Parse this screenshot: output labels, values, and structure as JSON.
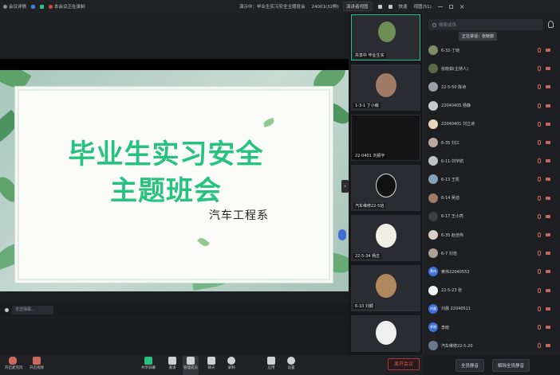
{
  "topbar": {
    "info_label": "会议详情",
    "recording_label": "本会议正在录制",
    "center_labels": [
      "演示中：毕业生实习安全主题班会",
      "24001(32种)"
    ],
    "layout_label": "演讲者视图",
    "right_labels": [
      "快速",
      "视图(51)"
    ]
  },
  "slide": {
    "title_line1": "毕业生实习安全",
    "title_line2": "主题班会",
    "subtitle": "汽车工程系"
  },
  "stage_bottom": {
    "annotation_placeholder": "发送弹幕..."
  },
  "videos": [
    {
      "name": "共享中 毕业生实",
      "active": true,
      "avatar_color": "#6f8e56"
    },
    {
      "name": "1-3-1 丁小萌",
      "active": false,
      "avatar_color": "#a07c66"
    },
    {
      "name": "22-0401 刘振宇",
      "active": false,
      "avatar_color": "#141414"
    },
    {
      "name": "汽车维修22-5班",
      "active": false,
      "avatar_color": "#111111"
    },
    {
      "name": "22-5-34 杨志",
      "active": false,
      "avatar_color": "#f1efe5"
    },
    {
      "name": "6-10 刘顺",
      "active": false,
      "avatar_color": "#b08860"
    },
    {
      "name": "",
      "active": false,
      "avatar_color": "#f0f0f0"
    }
  ],
  "panel": {
    "search_placeholder": "搜索成员",
    "tooltip": "正在讲话：张晓茹",
    "participants": [
      {
        "name": "6-32-丁晓",
        "initials": "",
        "color": "#7a8d6a"
      },
      {
        "name": "张晓茹(主持人)",
        "initials": "",
        "color": "#5b6b4a"
      },
      {
        "name": "22-5-50 陈诗",
        "initials": "",
        "color": "#9aa0a8"
      },
      {
        "name": "22040405 杨静",
        "initials": "",
        "color": "#c9c9c9"
      },
      {
        "name": "22040401 刘立诗",
        "initials": "",
        "color": "#e8d7b8"
      },
      {
        "name": "6-35 刘江",
        "initials": "",
        "color": "#b9a8a0"
      },
      {
        "name": "6-11-刘宇航",
        "initials": "",
        "color": "#c2c2c2"
      },
      {
        "name": "6-13 王凯",
        "initials": "",
        "color": "#8aa0b5"
      },
      {
        "name": "6-14 吴迪",
        "initials": "",
        "color": "#a07c66"
      },
      {
        "name": "6-17 王小亮",
        "initials": "",
        "color": "#3c3c3c"
      },
      {
        "name": "6-35 赵佳伟",
        "initials": "",
        "color": "#d8d0c4"
      },
      {
        "name": "6-7 刘浩",
        "initials": "",
        "color": "#b0a090"
      },
      {
        "name": "黄伟22040553",
        "initials": "黄伟",
        "color": "#3f6fd6"
      },
      {
        "name": "22-5-23 张",
        "initials": "",
        "color": "#f2f2f2"
      },
      {
        "name": "刘晨 22040511",
        "initials": "刘晨",
        "color": "#3f6fd6"
      },
      {
        "name": "李晓",
        "initials": "李晓",
        "color": "#3f6fd6"
      },
      {
        "name": "汽车维修22-5-20",
        "initials": "",
        "color": "#6b7a8a"
      }
    ],
    "footer_buttons": [
      "全员静音",
      "解除全员静音"
    ]
  },
  "toolbar": {
    "left_tools": [
      "开启麦克风",
      "开启视频"
    ],
    "center_tools": [
      "共享屏幕",
      "邀请",
      "管理成员",
      "聊天",
      "录制",
      "应用",
      "设置"
    ],
    "leave_label": "离开会议"
  }
}
